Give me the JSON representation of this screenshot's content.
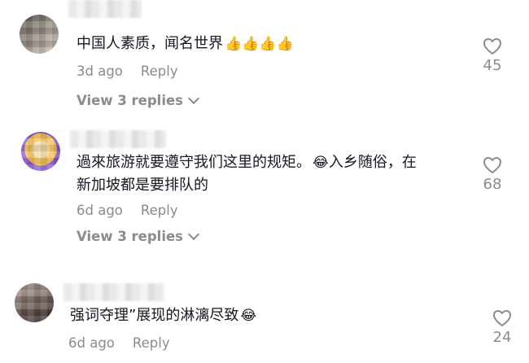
{
  "comments": [
    {
      "text": "中国人素质，闻名世界",
      "emoji": "👍👍👍👍",
      "time": "3d ago",
      "reply_label": "Reply",
      "view_replies": "View 3 replies",
      "likes": "45"
    },
    {
      "text_line1": "過來旅游就要遵守我们这里的规矩。",
      "emoji_mid": "😂",
      "text_line1_cont": "入乡随俗，在",
      "text_line2": "新加坡都是要排队的",
      "time": "6d ago",
      "reply_label": "Reply",
      "view_replies": "View 3 replies",
      "likes": "68"
    },
    {
      "text": "强词夺理”展现的淋漓尽致",
      "emoji": "😂",
      "time": "6d ago",
      "reply_label": "Reply",
      "likes": "24"
    }
  ],
  "icons": {
    "like": "heart-outline-icon",
    "expand": "chevron-down-icon"
  },
  "colors": {
    "text": "#161823",
    "muted": "#8a8b91"
  }
}
